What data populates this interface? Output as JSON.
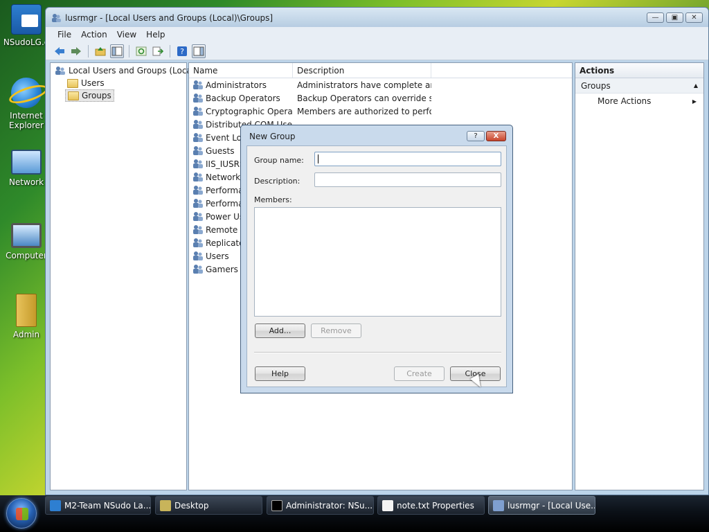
{
  "desktop": {
    "icons": [
      {
        "label": "NSudoLG.e"
      },
      {
        "label": "Internet Explorer"
      },
      {
        "label": "Network"
      },
      {
        "label": "Computer"
      },
      {
        "label": "Admin"
      }
    ]
  },
  "window": {
    "title": "lusrmgr - [Local Users and Groups (Local)\\Groups]",
    "menu": [
      "File",
      "Action",
      "View",
      "Help"
    ]
  },
  "tree": {
    "root": "Local Users and Groups (Local)",
    "children": [
      "Users",
      "Groups"
    ],
    "selected": "Groups"
  },
  "list": {
    "columns": [
      "Name",
      "Description"
    ],
    "rows": [
      {
        "name": "Administrators",
        "desc": "Administrators have complete an..."
      },
      {
        "name": "Backup Operators",
        "desc": "Backup Operators can override se..."
      },
      {
        "name": "Cryptographic Operat...",
        "desc": "Members are authorized to perfor..."
      },
      {
        "name": "Distributed COM Users",
        "desc": ""
      },
      {
        "name": "Event Log",
        "desc": ""
      },
      {
        "name": "Guests",
        "desc": ""
      },
      {
        "name": "IIS_IUSRS",
        "desc": ""
      },
      {
        "name": "Network C",
        "desc": ""
      },
      {
        "name": "Performan",
        "desc": ""
      },
      {
        "name": "Performan",
        "desc": ""
      },
      {
        "name": "Power Use",
        "desc": ""
      },
      {
        "name": "Remote D",
        "desc": ""
      },
      {
        "name": "Replicator",
        "desc": ""
      },
      {
        "name": "Users",
        "desc": ""
      },
      {
        "name": "Gamers",
        "desc": ""
      }
    ]
  },
  "actions": {
    "header": "Actions",
    "section": "Groups",
    "items": [
      "More Actions"
    ]
  },
  "dialog": {
    "title": "New Group",
    "help_glyph": "?",
    "close_glyph": "X",
    "group_name_label": "Group name:",
    "group_name_value": "",
    "description_label": "Description:",
    "description_value": "",
    "members_label": "Members:",
    "add_label": "Add...",
    "remove_label": "Remove",
    "help_label": "Help",
    "create_label": "Create",
    "close_label": "Close"
  },
  "taskbar": {
    "items": [
      {
        "label": "M2-Team NSudo La...",
        "active": false
      },
      {
        "label": "Desktop",
        "active": false
      },
      {
        "label": "Administrator: NSu...",
        "active": false
      },
      {
        "label": "note.txt Properties",
        "active": false
      },
      {
        "label": "lusrmgr - [Local Use...",
        "active": true
      }
    ]
  },
  "colors": {
    "accent": "#3a78c2",
    "window_frame": "#bcd4e9",
    "dialog_close": "#c8452c"
  }
}
